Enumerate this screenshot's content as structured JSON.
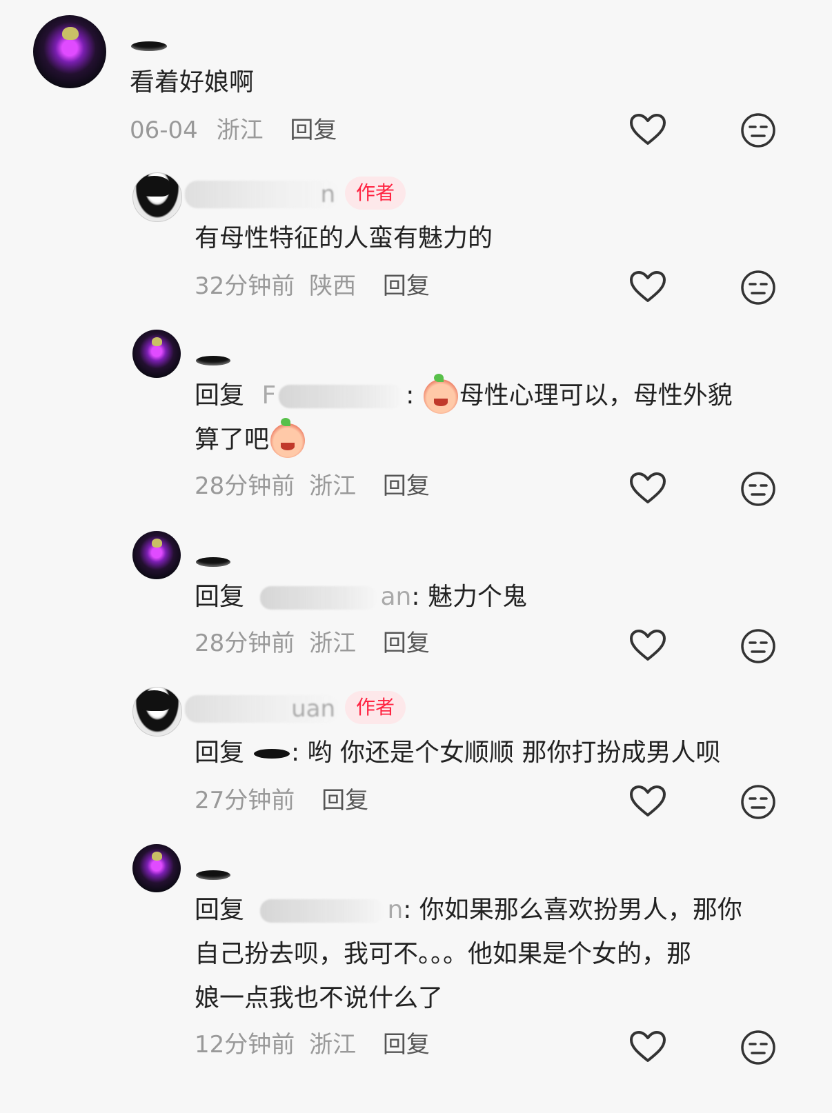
{
  "comments": [
    {
      "text": "看着好娘啊",
      "time": "06-04",
      "location": "浙江",
      "reply_label": "回复"
    },
    {
      "name_visible": "n",
      "badge": "作者",
      "text": "有母性特征的人蛮有魅力的",
      "time": "32分钟前",
      "location": "陕西",
      "reply_label": "回复"
    },
    {
      "reply_prefix": "回复",
      "reply_to_visible": "F",
      "text_part1": "母性心理可以，母性外貌",
      "text_part2": "算了吧",
      "emoji": "crying-laughing-emoji",
      "time": "28分钟前",
      "location": "浙江",
      "reply_label": "回复"
    },
    {
      "reply_prefix": "回复",
      "reply_to_visible": "an",
      "text": "魅力个鬼",
      "time": "28分钟前",
      "location": "浙江",
      "reply_label": "回复"
    },
    {
      "name_visible": "uan",
      "badge": "作者",
      "reply_prefix": "回复",
      "text": "哟 你还是个女顺顺 那你打扮成男人呗",
      "time": "27分钟前",
      "reply_label": "回复"
    },
    {
      "reply_prefix": "回复",
      "reply_to_visible": "n",
      "text_line1": "你如果那么喜欢扮男人，那你",
      "text_line2": "自己扮去呗，我可不。。。他如果是个女的，那",
      "text_line3": "娘一点我也不说什么了",
      "time": "12分钟前",
      "location": "浙江",
      "reply_label": "回复"
    }
  ],
  "colors": {
    "background": "#f7f7f7",
    "author_badge_text": "#ff2442",
    "author_badge_bg": "#fde8ea",
    "meta_text": "#999999"
  }
}
